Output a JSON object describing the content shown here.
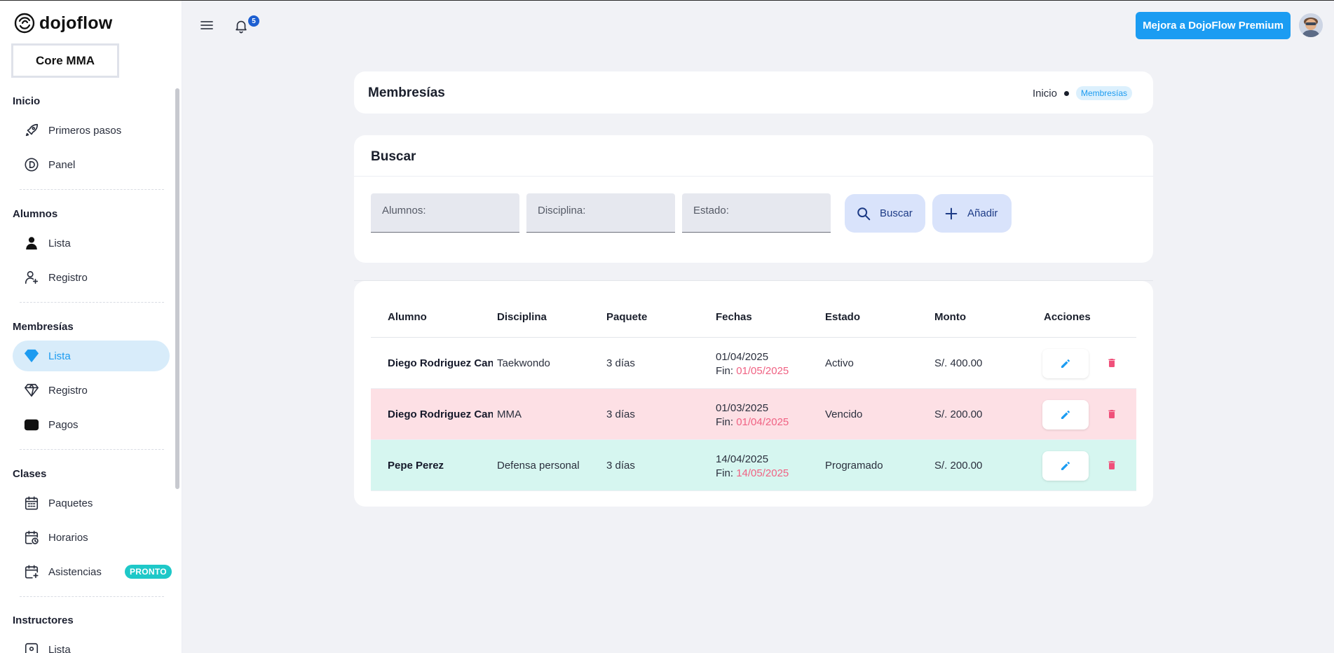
{
  "brand": {
    "name": "dojoflow"
  },
  "org": {
    "name": "Core MMA"
  },
  "sidebar": {
    "sections": [
      {
        "title": "Inicio",
        "items": [
          {
            "label": "Primeros pasos",
            "icon": "rocket-icon"
          },
          {
            "label": "Panel",
            "icon": "panel-icon"
          }
        ]
      },
      {
        "title": "Alumnos",
        "items": [
          {
            "label": "Lista",
            "icon": "user-icon"
          },
          {
            "label": "Registro",
            "icon": "user-plus-icon"
          }
        ]
      },
      {
        "title": "Membresías",
        "items": [
          {
            "label": "Lista",
            "icon": "diamond-icon",
            "active": true
          },
          {
            "label": "Registro",
            "icon": "diamond-outline-icon"
          },
          {
            "label": "Pagos",
            "icon": "wallet-icon"
          }
        ]
      },
      {
        "title": "Clases",
        "items": [
          {
            "label": "Paquetes",
            "icon": "calendar-icon"
          },
          {
            "label": "Horarios",
            "icon": "calendar-clock-icon"
          },
          {
            "label": "Asistencias",
            "icon": "calendar-plus-icon",
            "badge": "PRONTO"
          }
        ]
      },
      {
        "title": "Instructores",
        "items": [
          {
            "label": "Lista",
            "icon": "badge-icon"
          }
        ]
      }
    ]
  },
  "topbar": {
    "notifications_count": "5",
    "premium_label": "Mejora a DojoFlow Premium"
  },
  "page": {
    "title": "Membresías",
    "breadcrumb": {
      "home": "Inicio",
      "current": "Membresías"
    }
  },
  "search": {
    "title": "Buscar",
    "fields": {
      "alumnos": "Alumnos:",
      "disciplina": "Disciplina:",
      "estado": "Estado:"
    },
    "search_label": "Buscar",
    "add_label": "Añadir"
  },
  "table": {
    "headers": [
      "Alumno",
      "Disciplina",
      "Paquete",
      "Fechas",
      "Estado",
      "Monto",
      "Acciones"
    ],
    "end_prefix": "Fin:",
    "rows": [
      {
        "alumno": "Diego Rodriguez Cano",
        "disciplina": "Taekwondo",
        "paquete": "3 días",
        "inicio": "01/04/2025",
        "fin": "01/05/2025",
        "estado": "Activo",
        "monto": "S/. 400.00"
      },
      {
        "alumno": "Diego Rodriguez Cano",
        "disciplina": "MMA",
        "paquete": "3 días",
        "inicio": "01/03/2025",
        "fin": "01/04/2025",
        "estado": "Vencido",
        "monto": "S/. 200.00"
      },
      {
        "alumno": "Pepe Perez",
        "disciplina": "Defensa personal",
        "paquete": "3 días",
        "inicio": "14/04/2025",
        "fin": "14/05/2025",
        "estado": "Programado",
        "monto": "S/. 200.00"
      }
    ]
  },
  "colors": {
    "accent": "#1b9cf2",
    "active_bg": "#d8ecfa",
    "vencido_row": "#fde0e5",
    "programado_row": "#d6f6f0",
    "date_end": "#f06283",
    "delete": "#f0507a",
    "badge": "#1ec8c8"
  }
}
